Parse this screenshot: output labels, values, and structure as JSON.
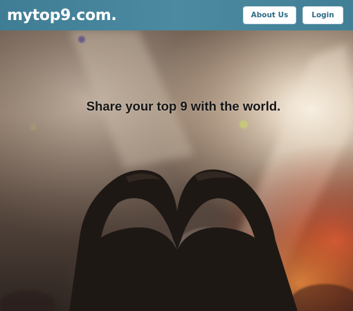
{
  "header": {
    "logo": "mytop9.com.",
    "nav": {
      "about_label": "About Us",
      "login_label": "Login"
    }
  },
  "hero": {
    "tagline": "Share your top 9 with the world.",
    "background_image": "concert-heart-hands-photo"
  },
  "colors": {
    "header_bg": "#4686a0",
    "button_text": "#2f6c86",
    "tagline_text": "#161616"
  }
}
